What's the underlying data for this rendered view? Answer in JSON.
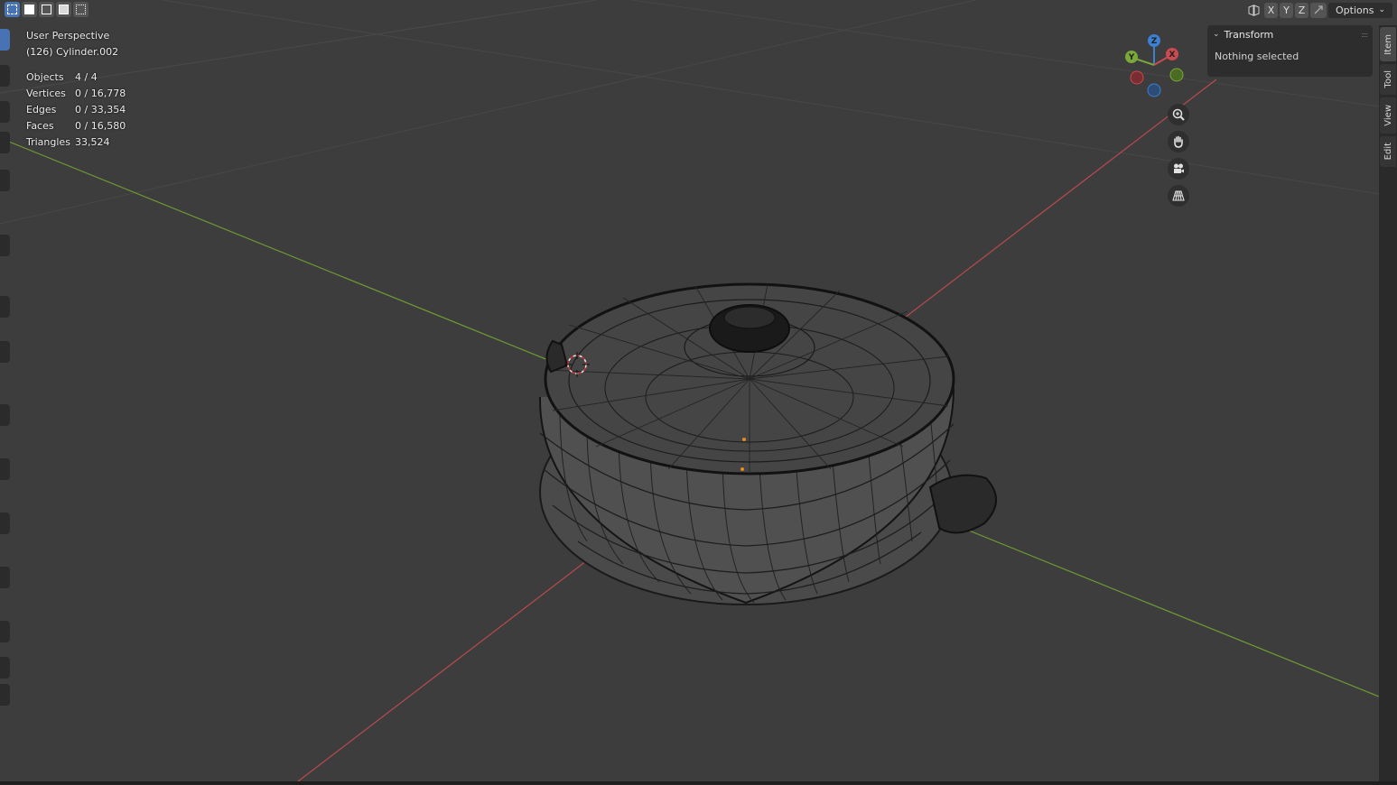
{
  "viewport": {
    "view_name": "User Perspective",
    "active_object": "(126) Cylinder.002"
  },
  "stats": [
    {
      "label": "Objects",
      "value": "4 / 4"
    },
    {
      "label": "Vertices",
      "value": "0 / 16,778"
    },
    {
      "label": "Edges",
      "value": "0 / 33,354"
    },
    {
      "label": "Faces",
      "value": "0 / 16,580"
    },
    {
      "label": "Triangles",
      "value": "33,524"
    }
  ],
  "header": {
    "axis_x": "X",
    "axis_y": "Y",
    "axis_z": "Z",
    "options": "Options",
    "options_chevron": "⌄"
  },
  "gizmo": {
    "x": "X",
    "y": "Y",
    "z": "Z"
  },
  "npanel": {
    "title": "Transform",
    "chevron": "⌄",
    "dots": "::::",
    "message": "Nothing selected"
  },
  "sidebar_tabs": [
    "Item",
    "Tool",
    "View",
    "Edit"
  ],
  "colors": {
    "background": "#3d3d3d",
    "x_axis": "#c94a4f",
    "y_axis": "#7aa83a",
    "z_axis": "#3d7fd1",
    "accent": "#4772b3"
  },
  "icons": {
    "zoom": "zoom-in-icon",
    "pan": "hand-pan-icon",
    "camera": "camera-view-icon",
    "ortho": "grid-perspective-icon"
  }
}
